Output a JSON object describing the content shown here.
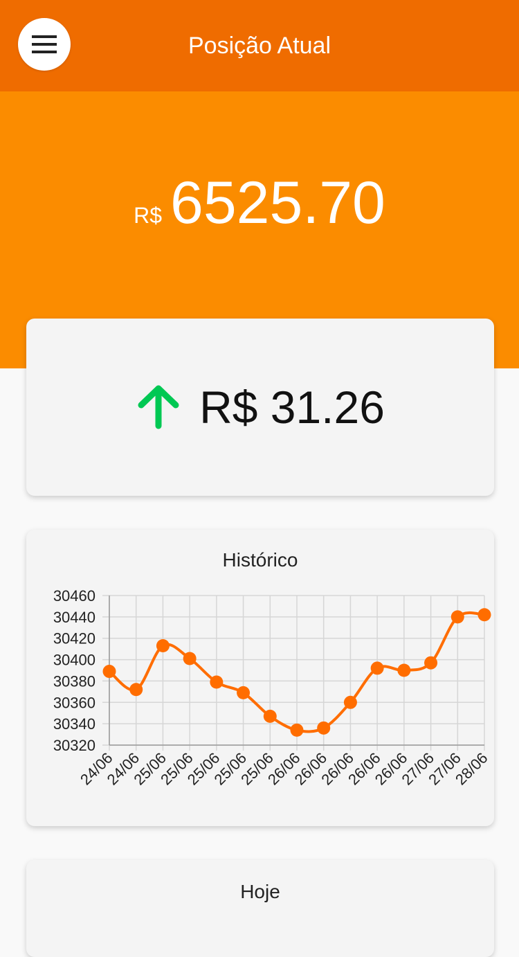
{
  "header": {
    "title": "Posição Atual",
    "menu_icon": "hamburger-menu-icon"
  },
  "balance": {
    "currency": "R$",
    "value": "6525.70"
  },
  "change": {
    "direction_icon": "arrow-up-icon",
    "text": "R$ 31.26",
    "color": "#00c853"
  },
  "history": {
    "title": "Histórico"
  },
  "today": {
    "title": "Hoje"
  },
  "colors": {
    "header": "#ef6c00",
    "hero": "#fb8c00",
    "series": "#ff6d00"
  },
  "chart_data": {
    "type": "line",
    "title": "Histórico",
    "categories": [
      "24/06",
      "24/06",
      "25/06",
      "25/06",
      "25/06",
      "25/06",
      "25/06",
      "26/06",
      "26/06",
      "26/06",
      "26/06",
      "26/06",
      "27/06",
      "27/06",
      "28/06"
    ],
    "values": [
      30389,
      30372,
      30413,
      30401,
      30379,
      30369,
      30347,
      30334,
      30336,
      30360,
      30392,
      30390,
      30397,
      30440,
      30442
    ],
    "ylim": [
      30320,
      30460
    ],
    "yticks": [
      30320,
      30340,
      30360,
      30380,
      30400,
      30420,
      30440,
      30460
    ],
    "grid": true,
    "smooth": true
  }
}
